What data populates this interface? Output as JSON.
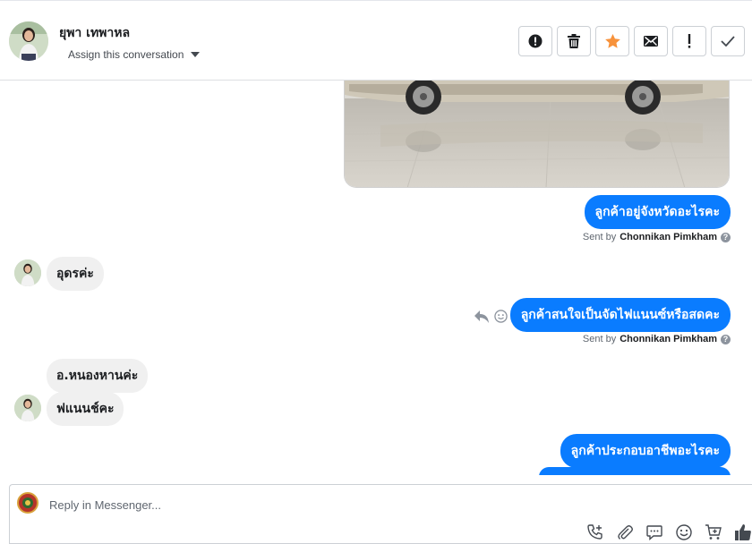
{
  "header": {
    "contact_name": "ยุพา เทพาหล",
    "assign_label": "Assign this conversation"
  },
  "toolbar": {
    "buttons": [
      "spam-icon",
      "trash-icon",
      "star-icon",
      "envelope-icon",
      "exclamation-icon",
      "check-icon"
    ],
    "star_color": "#f7923b"
  },
  "thread": {
    "messages": [
      {
        "direction": "out",
        "text": "ลูกค้าอยู่จังหวัดอะไรคะ"
      },
      {
        "sent_by_prefix": "Sent by",
        "sent_by_name": "Chonnikan Pimkham"
      },
      {
        "direction": "in",
        "text": "อุดรค่ะ"
      },
      {
        "direction": "out",
        "text": "ลูกค้าสนใจเป็นจัดไฟแนนซ์หรือสดคะ"
      },
      {
        "sent_by_prefix": "Sent by",
        "sent_by_name": "Chonnikan Pimkham"
      },
      {
        "direction": "in",
        "text": "อ.หนองหานค่ะ"
      },
      {
        "direction": "in",
        "text": "ฟแนนช์คะ"
      },
      {
        "direction": "out",
        "text": "ลูกค้าประกอบอาชีพอะไรคะ"
      }
    ],
    "bubble_color": "#0a7cff"
  },
  "composer": {
    "placeholder": "Reply in Messenger...",
    "tools": [
      "add-call-icon",
      "attachment-icon",
      "saved-reply-icon",
      "emoji-icon",
      "cart-icon",
      "thumbs-up-icon"
    ]
  }
}
